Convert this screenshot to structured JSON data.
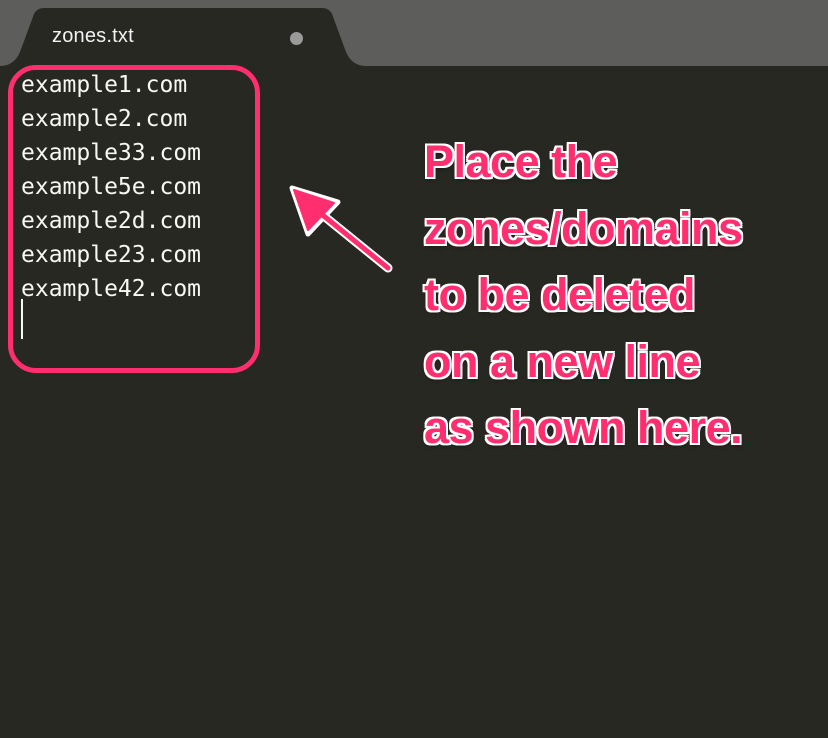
{
  "tab": {
    "title": "zones.txt",
    "unsaved_indicator": "dot"
  },
  "editor": {
    "lines": [
      "example1.com",
      "example2.com",
      "example33.com",
      "example5e.com",
      "example2d.com",
      "example23.com",
      "example42.com"
    ]
  },
  "annotation": {
    "lines": [
      "Place the",
      "zones/domains",
      "to be deleted",
      "on a new line",
      "as shown here."
    ],
    "arrow_icon": "arrow-pointing-left-up-icon"
  },
  "colors": {
    "editor_bg": "#272822",
    "tabbar_bg": "#5d5d5b",
    "tab_active_bg": "#272822",
    "text": "#f8f8f2",
    "annotation": "#ff2e6e"
  }
}
